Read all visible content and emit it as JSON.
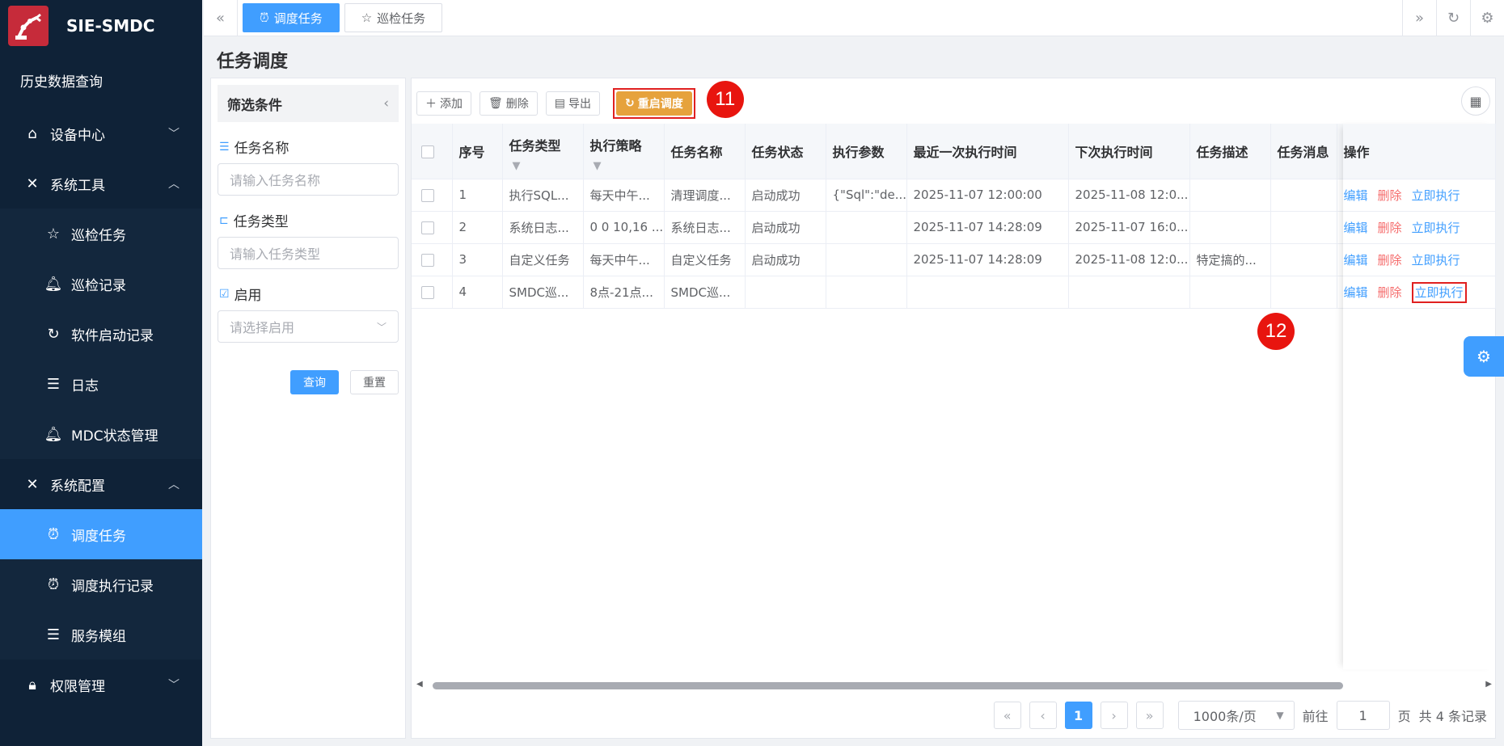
{
  "app": {
    "name": "SIE-SMDC"
  },
  "sidebar": {
    "history": "历史数据查询",
    "device_center": "设备中心",
    "system_tools": "系统工具",
    "tools_items": [
      "巡检任务",
      "巡检记录",
      "软件启动记录",
      "日志",
      "MDC状态管理"
    ],
    "system_config": "系统配置",
    "config_items": [
      "调度任务",
      "调度执行记录",
      "服务模组"
    ],
    "permission": "权限管理"
  },
  "tabs": [
    {
      "label": "调度任务",
      "icon": "clock-icon",
      "active": true
    },
    {
      "label": "巡检任务",
      "icon": "star-icon",
      "active": false
    }
  ],
  "page_title": "任务调度",
  "filter": {
    "title": "筛选条件",
    "task_name_label": "任务名称",
    "task_name_placeholder": "请输入任务名称",
    "task_type_label": "任务类型",
    "task_type_placeholder": "请输入任务类型",
    "enabled_label": "启用",
    "enabled_placeholder": "请选择启用",
    "query": "查询",
    "reset": "重置"
  },
  "toolbar": {
    "add": "添加",
    "delete": "删除",
    "export": "导出",
    "restart": "重启调度"
  },
  "annotations": {
    "a": "11",
    "b": "12"
  },
  "table": {
    "headers": [
      "序号",
      "任务类型",
      "执行策略",
      "任务名称",
      "任务状态",
      "执行参数",
      "最近一次执行时间",
      "下次执行时间",
      "任务描述",
      "任务消息",
      "操作"
    ],
    "rows": [
      [
        "1",
        "执行SQL...",
        "每天中午...",
        "清理调度...",
        "启动成功",
        "{\"Sql\":\"de...",
        "2025-11-07 12:00:00",
        "2025-11-08 12:0...",
        "",
        ""
      ],
      [
        "2",
        "系统日志...",
        "0 0 10,16 ...",
        "系统日志...",
        "启动成功",
        "",
        "2025-11-07 14:28:09",
        "2025-11-07 16:0...",
        "",
        ""
      ],
      [
        "3",
        "自定义任务",
        "每天中午...",
        "自定义任务",
        "启动成功",
        "",
        "2025-11-07 14:28:09",
        "2025-11-08 12:0...",
        "特定搞的...",
        ""
      ],
      [
        "4",
        "SMDC巡...",
        "8点-21点...",
        "SMDC巡...",
        "",
        "",
        "",
        "",
        "",
        ""
      ]
    ],
    "ops": {
      "edit": "编辑",
      "delete": "删除",
      "run": "立即执行"
    }
  },
  "pager": {
    "current": "1",
    "size": "1000条/页",
    "goto": "前往",
    "goto_value": "1",
    "page_unit": "页",
    "total": "共 4 条记录"
  }
}
